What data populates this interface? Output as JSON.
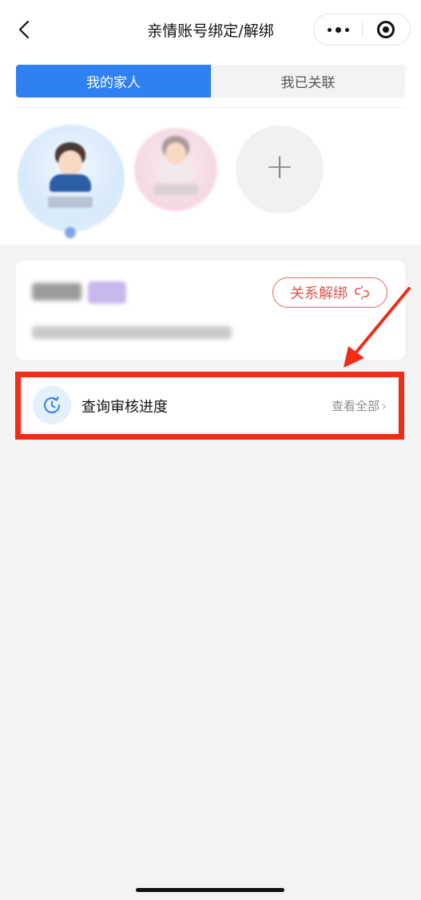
{
  "nav": {
    "title": "亲情账号绑定/解绑"
  },
  "tabs": [
    {
      "label": "我的家人",
      "active": true
    },
    {
      "label": "我已关联",
      "active": false
    }
  ],
  "family": {
    "add_symbol": "+"
  },
  "member_card": {
    "unbind_label": "关系解绑"
  },
  "progress": {
    "label": "查询审核进度",
    "view_all": "查看全部",
    "chevron": "›"
  },
  "colors": {
    "accent": "#2f80f1",
    "unbind": "#e0564a",
    "annotation": "#f02d17",
    "background": "#f3f3f3"
  },
  "icons": [
    "back-icon",
    "more-icon",
    "close-mini-program-icon",
    "unlink-icon",
    "clock-icon",
    "chevron-right-icon"
  ]
}
